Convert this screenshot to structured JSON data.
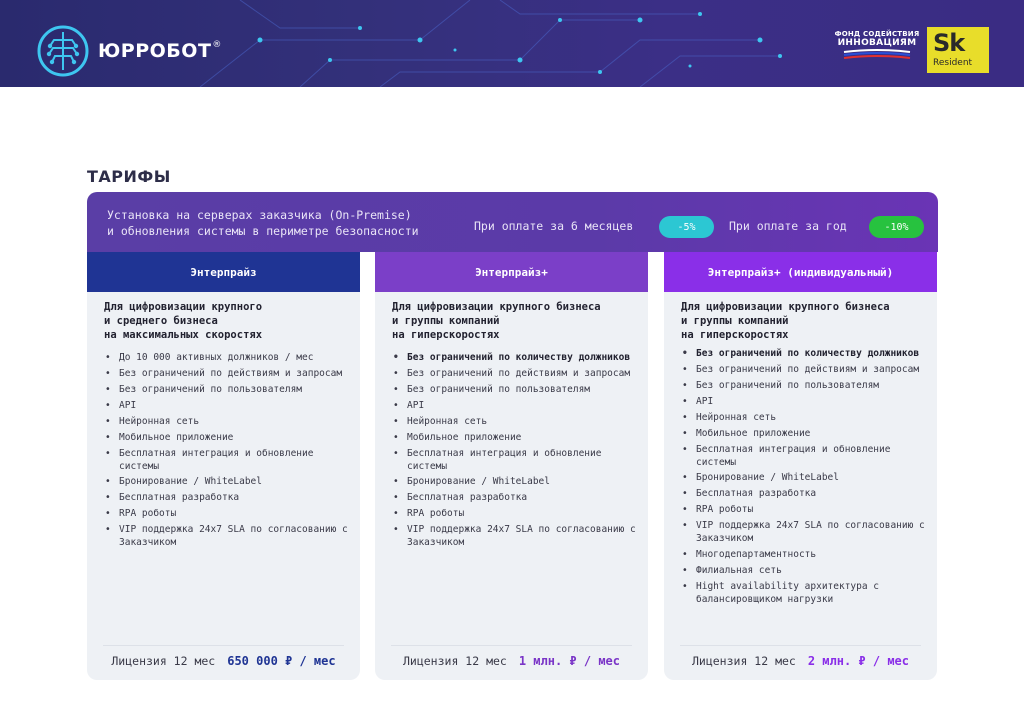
{
  "header": {
    "logo_name": "ЮРРОБОТ",
    "logo_reg": "®",
    "fund_line1": "ФОНД СОДЕЙСТВИЯ",
    "fund_line2": "ИННОВАЦИЯМ",
    "sk_big": "Sk",
    "sk_small": "Resident"
  },
  "page": {
    "title": "ТАРИФЫ"
  },
  "topbar": {
    "desc_line1": "Установка на серверах заказчика (On-Premise)",
    "desc_line2": "и обновления системы в периметре безопасности",
    "pay_6m": "При оплате за 6 месяцев",
    "discount_6m": "-5%",
    "pay_year": "При оплате за год",
    "discount_year": "-10%"
  },
  "colors": {
    "col1_head": "#1f3494",
    "col2_head": "#7b3fc8",
    "col3_head": "#8a2fe8",
    "pill_cyan": "#2cc7d3",
    "pill_green": "#27c23f",
    "price_navy": "#1f3494",
    "price_purple": "#7a35c7",
    "price_violet": "#8a2fe8"
  },
  "tariffs": [
    {
      "name": "Энтерпрайз",
      "sub_line1": "Для цифровизации крупного",
      "sub_line2": "и среднего бизнеса",
      "sub_line3": "на максимальных скоростях",
      "features": [
        "До 10 000 активных должников / мес",
        "Без ограничений по действиям и запросам",
        "Без ограничений по пользователям",
        "API",
        "Нейронная сеть",
        "Мобильное приложение",
        "Бесплатная интеграция и обновление системы",
        "Бронирование / WhiteLabel",
        "Бесплатная разработка",
        "RPA роботы",
        "VIP поддержка 24x7 SLA по согласованию с Заказчиком"
      ],
      "license_label": "Лицензия 12 мес",
      "price": "650 000 ₽ / мес"
    },
    {
      "name": "Энтерпрайз+",
      "sub_line1": "Для цифровизации крупного бизнеса",
      "sub_line2": "и группы компаний",
      "sub_line3": "на гиперскоростях",
      "features": [
        "Без ограничений по количеству должников",
        "Без ограничений по действиям и запросам",
        "Без ограничений по пользователям",
        "API",
        "Нейронная сеть",
        "Мобильное приложение",
        "Бесплатная интеграция и обновление системы",
        "Бронирование / WhiteLabel",
        "Бесплатная разработка",
        "RPA роботы",
        "VIP поддержка 24x7 SLA по согласованию с Заказчиком"
      ],
      "license_label": "Лицензия 12 мес",
      "price": "1 млн. ₽ / мес"
    },
    {
      "name": "Энтерпрайз+ (индивидуальный)",
      "sub_line1": "Для цифровизации крупного бизнеса",
      "sub_line2": "и группы компаний",
      "sub_line3": "на гиперскоростях",
      "features": [
        "Без ограничений по количеству должников",
        "Без ограничений по действиям и запросам",
        "Без ограничений по пользователям",
        "API",
        "Нейронная сеть",
        "Мобильное приложение",
        "Бесплатная интеграция и обновление системы",
        "Бронирование / WhiteLabel",
        "Бесплатная разработка",
        "RPA роботы",
        "VIP поддержка 24x7 SLA по согласованию с Заказчиком",
        "Многодепартаментность",
        "Филиальная сеть",
        "Hight availability архитектура с балансировщиком нагрузки"
      ],
      "license_label": "Лицензия 12 мес",
      "price": "2 млн. ₽ / мес"
    }
  ]
}
